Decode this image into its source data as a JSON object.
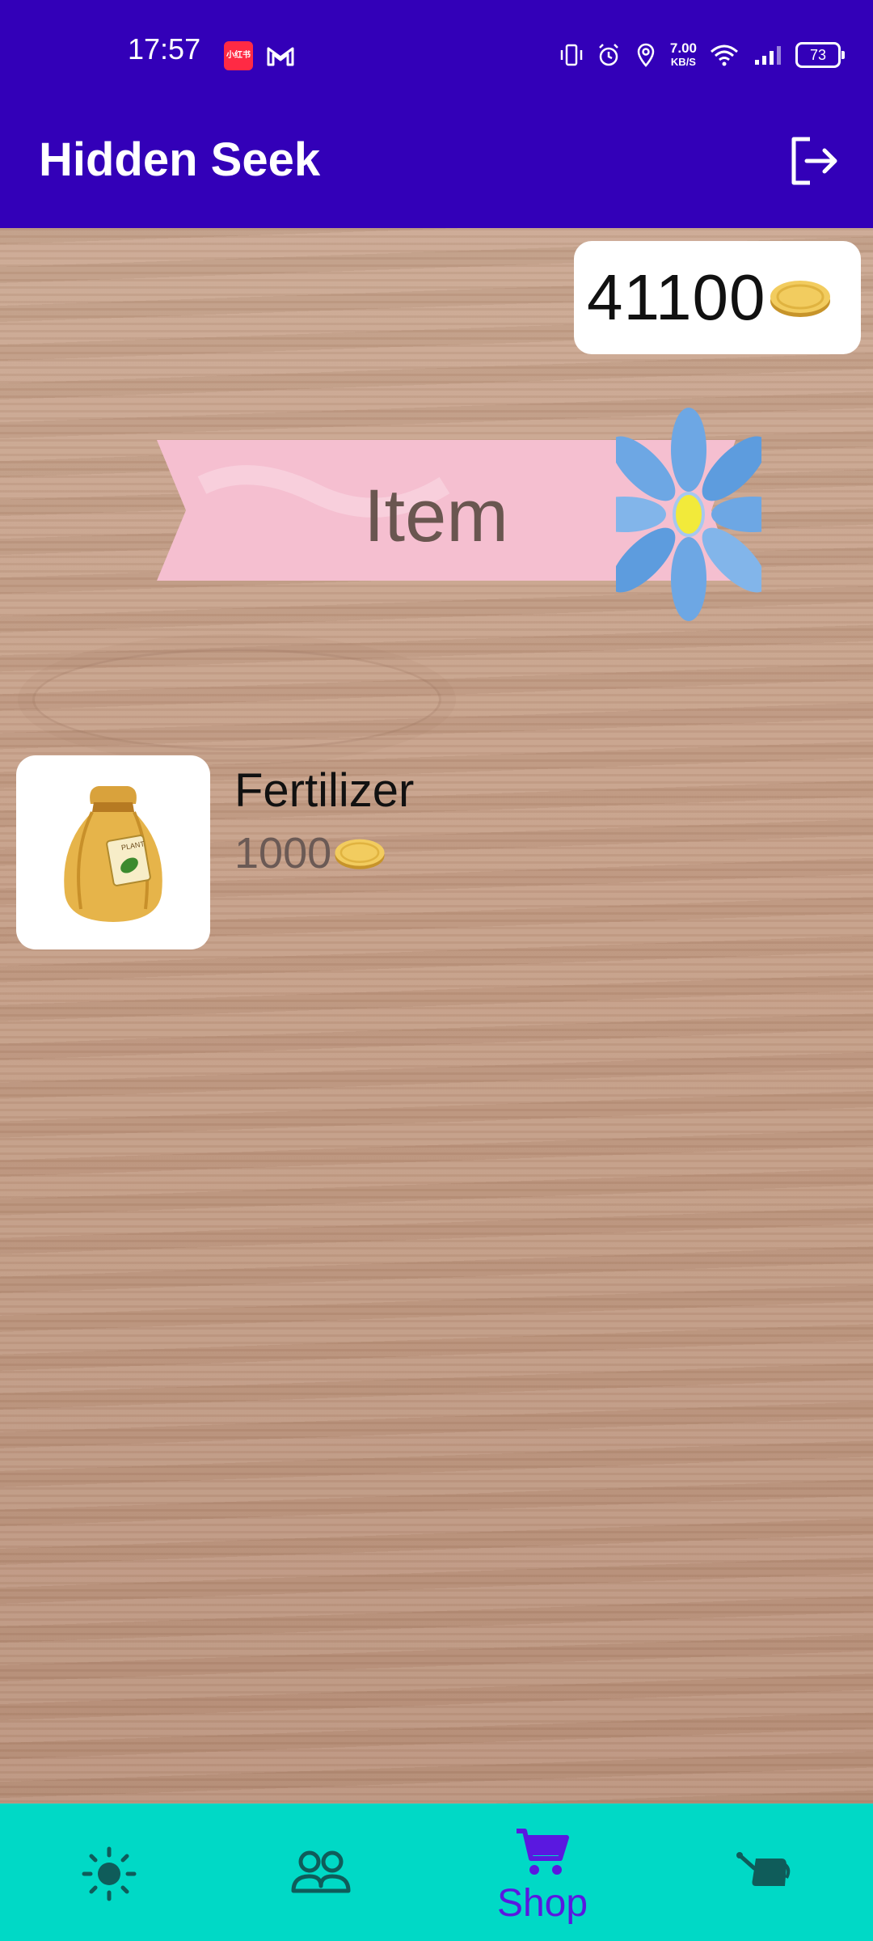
{
  "status_bar": {
    "time": "17:57",
    "app_icon_label": "小红书",
    "net_speed_value": "7.00",
    "net_speed_unit": "KB/S",
    "battery": "73"
  },
  "app_bar": {
    "title": "Hidden Seek",
    "logout_icon": "logout-icon"
  },
  "coins": {
    "amount": "41100"
  },
  "banner": {
    "label": "Item"
  },
  "items": [
    {
      "name": "Fertilizer",
      "price": "1000",
      "bag_label": "PLANT"
    }
  ],
  "bottom_nav": {
    "tabs": [
      {
        "icon": "sun-icon",
        "label": ""
      },
      {
        "icon": "friends-icon",
        "label": ""
      },
      {
        "icon": "shopping-cart-icon",
        "label": "Shop",
        "selected": true
      },
      {
        "icon": "watering-can-icon",
        "label": ""
      }
    ]
  },
  "colors": {
    "app_bar": "#3300b8",
    "nav_bar": "#00d9c6",
    "accent": "#5a18e0",
    "banner_pink": "#f5bfd0"
  }
}
